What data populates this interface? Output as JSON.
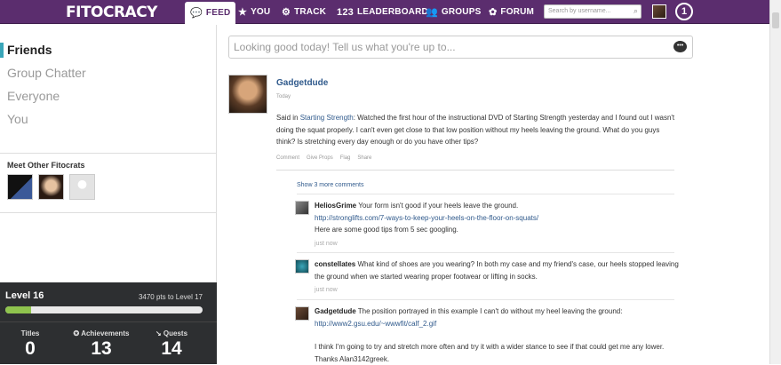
{
  "nav": {
    "logo": "FITOCRACY",
    "feed": "FEED",
    "you": "YOU",
    "track": "TRACK",
    "leaderboard_prefix": "123",
    "leaderboard": "LEADERBOARD",
    "groups": "GROUPS",
    "forum": "FORUM",
    "search_placeholder": "Search by username...",
    "level_badge": "1"
  },
  "sidebar": {
    "filters": [
      "Friends",
      "Group Chatter",
      "Everyone",
      "You"
    ],
    "meet_title": "Meet Other Fitocrats",
    "level": {
      "title": "Level 16",
      "points_to_next": "3470 pts to Level 17",
      "progress_fraction": 0.13
    },
    "stats": [
      {
        "label": "Titles",
        "value": "0"
      },
      {
        "label": "Achievements",
        "value": "13"
      },
      {
        "label": "Quests",
        "value": "14"
      }
    ]
  },
  "feed": {
    "status_placeholder": "Looking good today! Tell us what you're up to...",
    "post": {
      "author": "Gadgetdude",
      "date": "Today",
      "said_in_prefix": "Said in ",
      "group": "Starting Strength",
      "text": ": Watched the first hour of the instructional DVD of Starting Strength yesterday and I found out I wasn't doing the squat properly. I can't even get close to that low position without my heels leaving the ground. What do you guys think? Is stretching every day enough or do you have other tips?",
      "actions": [
        "Comment",
        "Give Props",
        "Flag",
        "Share"
      ]
    },
    "show_more": "Show 3 more comments",
    "comments": [
      {
        "author": "HeliosGrime",
        "text": "Your form isn't good if your heels leave the ground.",
        "link": "http://stronglifts.com/7-ways-to-keep-your-heels-on-the-floor-on-squats/",
        "extra": "Here are some good tips from 5 sec googling.",
        "time": "just now"
      },
      {
        "author": "constellates",
        "text": "What kind of shoes are you wearing? In both my case and my friend's case, our heels stopped leaving the ground when we started wearing proper footwear or lifting in socks.",
        "time": "just now"
      },
      {
        "author": "Gadgetdude",
        "text": "The position portrayed in this example I can't do without my heel leaving the ground:",
        "link": "http://www2.gsu.edu/~wwwfit/calf_2.gif",
        "extra": "I think I'm going to try and stretch more often and try it with a wider stance to see if that could get me any lower. Thanks Alan3142greek."
      }
    ]
  }
}
